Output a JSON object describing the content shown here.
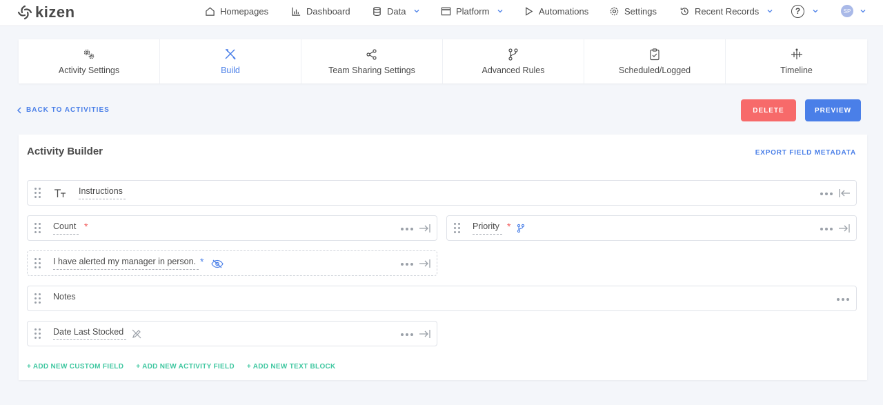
{
  "brand": {
    "name": "kizen"
  },
  "nav": {
    "homepages": "Homepages",
    "dashboard": "Dashboard",
    "data": "Data",
    "platform": "Platform",
    "automations": "Automations",
    "settings": "Settings",
    "recent": "Recent Records",
    "help": "?",
    "avatar": "SP"
  },
  "tabs": [
    {
      "label": "Activity Settings",
      "icon": "gears-icon"
    },
    {
      "label": "Build",
      "icon": "tools-icon",
      "active": true
    },
    {
      "label": "Team Sharing Settings",
      "icon": "share-icon"
    },
    {
      "label": "Advanced Rules",
      "icon": "branch-icon"
    },
    {
      "label": "Scheduled/Logged",
      "icon": "clipboard-check-icon"
    },
    {
      "label": "Timeline",
      "icon": "timeline-icon"
    }
  ],
  "back_label": "BACK TO ACTIVITIES",
  "buttons": {
    "delete": "DELETE",
    "preview": "PREVIEW"
  },
  "builder": {
    "title": "Activity Builder",
    "export": "EXPORT FIELD METADATA",
    "fields": {
      "instructions": "Instructions",
      "count": "Count",
      "priority": "Priority",
      "manager": "I have alerted my manager in person.",
      "notes": "Notes",
      "date": "Date Last Stocked",
      "required_mark": "*"
    },
    "add": {
      "custom": "+ ADD NEW CUSTOM FIELD",
      "activity": "+ ADD NEW ACTIVITY FIELD",
      "text": "+ ADD NEW TEXT BLOCK"
    }
  },
  "colors": {
    "accent": "#4a7fe8",
    "delete": "#f76a6a",
    "required": "#f25c5c",
    "add_link": "#3fc7a0"
  }
}
